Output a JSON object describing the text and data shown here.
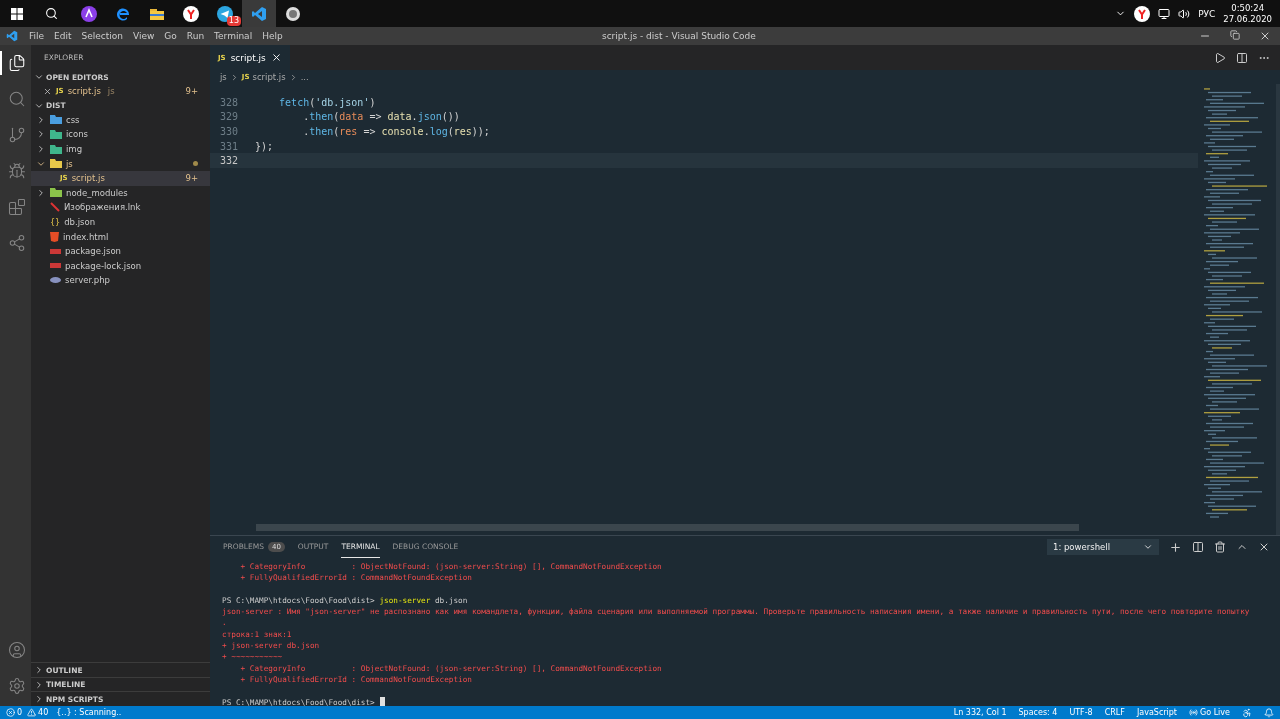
{
  "taskbar": {
    "apps": [
      {
        "kind": "alice",
        "selected": false
      },
      {
        "kind": "edge",
        "selected": false
      },
      {
        "kind": "folder",
        "selected": false
      },
      {
        "kind": "yandex",
        "selected": false
      },
      {
        "kind": "telegram",
        "selected": false,
        "badge": "13"
      },
      {
        "kind": "vscode",
        "selected": true
      },
      {
        "kind": "server",
        "selected": false
      }
    ],
    "tray": {
      "language": "РУС",
      "time": "0:50:24",
      "date": "27.06.2020"
    }
  },
  "window": {
    "title": "script.js - dist - Visual Studio Code",
    "menu": [
      "File",
      "Edit",
      "Selection",
      "View",
      "Go",
      "Run",
      "Terminal",
      "Help"
    ]
  },
  "activity_bar": [
    {
      "kind": "files",
      "selected": true
    },
    {
      "kind": "search",
      "selected": false
    },
    {
      "kind": "source-control",
      "selected": false
    },
    {
      "kind": "debug",
      "selected": false
    },
    {
      "kind": "extensions",
      "selected": false
    },
    {
      "kind": "live-share",
      "selected": false
    }
  ],
  "sidebar": {
    "title": "EXPLORER",
    "open_editors": {
      "title": "OPEN EDITORS",
      "expanded": true,
      "items": [
        {
          "name": "script.js",
          "icon": "JS",
          "folder": "js",
          "badge": "9+",
          "warn": true
        }
      ]
    },
    "folder": {
      "title": "DIST",
      "expanded": true,
      "items": [
        {
          "name": "css",
          "kind": "folder",
          "color": "#4a9ee0",
          "expanded": false,
          "selected": false,
          "warn": false
        },
        {
          "name": "icons",
          "kind": "folder",
          "color": "#3fb68b",
          "expanded": false,
          "selected": false,
          "warn": false
        },
        {
          "name": "img",
          "kind": "folder",
          "color": "#3fb68b",
          "expanded": false,
          "selected": false,
          "warn": false
        },
        {
          "name": "js",
          "kind": "folder",
          "color": "#e8c84a",
          "expanded": true,
          "selected": false,
          "warn": true,
          "children": [
            {
              "name": "script.js",
              "kind": "js",
              "icon": "JS",
              "selected": true,
              "warn": true,
              "badge": "9+"
            }
          ]
        },
        {
          "name": "node_modules",
          "kind": "folder",
          "color": "#8bc34a",
          "expanded": false,
          "selected": false,
          "warn": false
        },
        {
          "name": "Изображения.lnk",
          "kind": "link",
          "selected": false,
          "warn": false
        },
        {
          "name": "db.json",
          "kind": "json",
          "icon": "{}",
          "selected": false,
          "warn": false
        },
        {
          "name": "index.html",
          "kind": "html",
          "selected": false,
          "warn": false
        },
        {
          "name": "package.json",
          "kind": "npm",
          "selected": false,
          "warn": false
        },
        {
          "name": "package-lock.json",
          "kind": "npm",
          "selected": false,
          "warn": false
        },
        {
          "name": "server.php",
          "kind": "php",
          "selected": false,
          "warn": false
        }
      ]
    },
    "bottom_sections": [
      {
        "title": "OUTLINE",
        "expanded": false
      },
      {
        "title": "TIMELINE",
        "expanded": false
      },
      {
        "title": "NPM SCRIPTS",
        "expanded": false
      }
    ]
  },
  "editor": {
    "tabs": [
      {
        "label": "script.js",
        "icon": "JS",
        "selected": true
      }
    ],
    "breadcrumbs": [
      {
        "label": "js"
      },
      {
        "label": "script.js",
        "icon": "JS"
      },
      {
        "label": "..."
      }
    ],
    "lines": [
      {
        "number": "328",
        "current": false,
        "tokens": [
          {
            "kind": "fn",
            "text": "    fetch"
          },
          {
            "kind": "plain",
            "text": "("
          },
          {
            "kind": "str",
            "text": "'db.json'"
          },
          {
            "kind": "plain",
            "text": ")"
          }
        ]
      },
      {
        "number": "329",
        "current": false,
        "tokens": [
          {
            "kind": "plain",
            "text": "        ."
          },
          {
            "kind": "fn",
            "text": "then"
          },
          {
            "kind": "plain",
            "text": "("
          },
          {
            "kind": "param",
            "text": "data"
          },
          {
            "kind": "plain",
            "text": " => "
          },
          {
            "kind": "var",
            "text": "data"
          },
          {
            "kind": "plain",
            "text": "."
          },
          {
            "kind": "fn",
            "text": "json"
          },
          {
            "kind": "plain",
            "text": "())"
          }
        ]
      },
      {
        "number": "330",
        "current": false,
        "tokens": [
          {
            "kind": "plain",
            "text": "        ."
          },
          {
            "kind": "fn",
            "text": "then"
          },
          {
            "kind": "plain",
            "text": "("
          },
          {
            "kind": "param",
            "text": "res"
          },
          {
            "kind": "plain",
            "text": " => "
          },
          {
            "kind": "var",
            "text": "console"
          },
          {
            "kind": "plain",
            "text": "."
          },
          {
            "kind": "fn",
            "text": "log"
          },
          {
            "kind": "plain",
            "text": "("
          },
          {
            "kind": "var",
            "text": "res"
          },
          {
            "kind": "plain",
            "text": "));"
          }
        ]
      },
      {
        "number": "331",
        "current": false,
        "tokens": [
          {
            "kind": "plain",
            "text": "});"
          }
        ]
      },
      {
        "number": "332",
        "current": true
      }
    ]
  },
  "panel": {
    "tabs": [
      {
        "label": "PROBLEMS",
        "badge": "40",
        "selected": false
      },
      {
        "label": "OUTPUT",
        "selected": false
      },
      {
        "label": "TERMINAL",
        "selected": true
      },
      {
        "label": "DEBUG CONSOLE",
        "selected": false
      }
    ],
    "terminal_select": "1: powershell",
    "lines": [
      {
        "kind": "error",
        "text": "    + CategoryInfo          : ObjectNotFound: (json-server:String) [], CommandNotFoundException"
      },
      {
        "kind": "error",
        "text": "    + FullyQualifiedErrorId : CommandNotFoundException"
      },
      {
        "kind": "blank"
      },
      {
        "kind": "prompt",
        "prompt": "PS C:\\MAMP\\htdocs\\Food\\Food\\dist> ",
        "command": "json-server",
        "args": " db.json"
      },
      {
        "kind": "error",
        "text": "json-server : Имя \"json-server\" не распознано как имя командлета, функции, файла сценария или выполняемой программы. Проверьте правильность написания имени, а также наличие и правильность пути, после чего повторите попытку"
      },
      {
        "kind": "error",
        "text": "."
      },
      {
        "kind": "error",
        "text": "строка:1 знак:1"
      },
      {
        "kind": "error",
        "text": "+ json-server db.json"
      },
      {
        "kind": "error",
        "text": "+ ~~~~~~~~~~~"
      },
      {
        "kind": "error",
        "text": "    + CategoryInfo          : ObjectNotFound: (json-server:String) [], CommandNotFoundException"
      },
      {
        "kind": "error",
        "text": "    + FullyQualifiedErrorId : CommandNotFoundException"
      },
      {
        "kind": "blank"
      },
      {
        "kind": "prompt",
        "prompt": "PS C:\\MAMP\\htdocs\\Food\\Food\\dist>",
        "cursor": true
      }
    ]
  },
  "status_bar": {
    "errors": "0",
    "warnings": "40",
    "task": "{..} : Scanning..",
    "right": [
      "Ln 332, Col 1",
      "Spaces: 4",
      "UTF-8",
      "CRLF",
      "JavaScript"
    ],
    "go_live": "Go Live"
  }
}
